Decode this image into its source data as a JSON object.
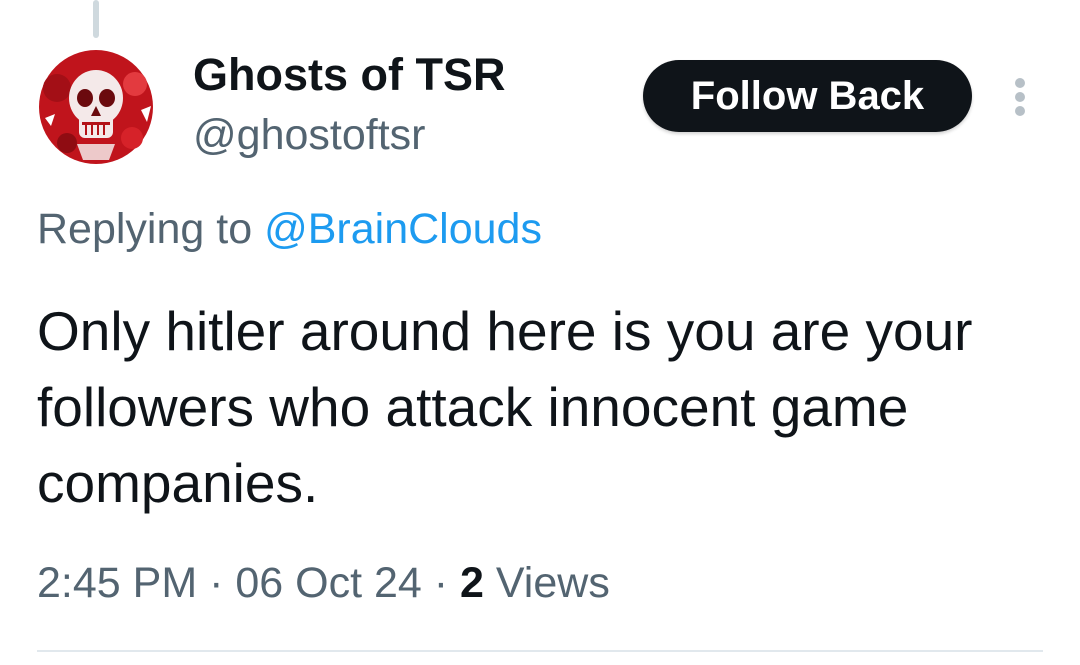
{
  "tweet": {
    "author": {
      "display_name": "Ghosts of TSR",
      "handle": "@ghostoftsr",
      "avatar_icon": "red-skull-avatar"
    },
    "follow_button_label": "Follow Back",
    "more_icon": "vertical-ellipsis-icon",
    "replying_prefix": "Replying to ",
    "replying_to": "@BrainClouds",
    "text": "Only hitler around here is you are your followers who attack innocent game companies.",
    "time": "2:45 PM",
    "separator": " · ",
    "date": "06 Oct 24",
    "views_count": "2",
    "views_label": " Views"
  },
  "colors": {
    "primary_text": "#0f1419",
    "secondary_text": "#536471",
    "mention_blue": "#1d9bf0",
    "button_bg": "#0f1419",
    "avatar_red": "#c0141c"
  }
}
